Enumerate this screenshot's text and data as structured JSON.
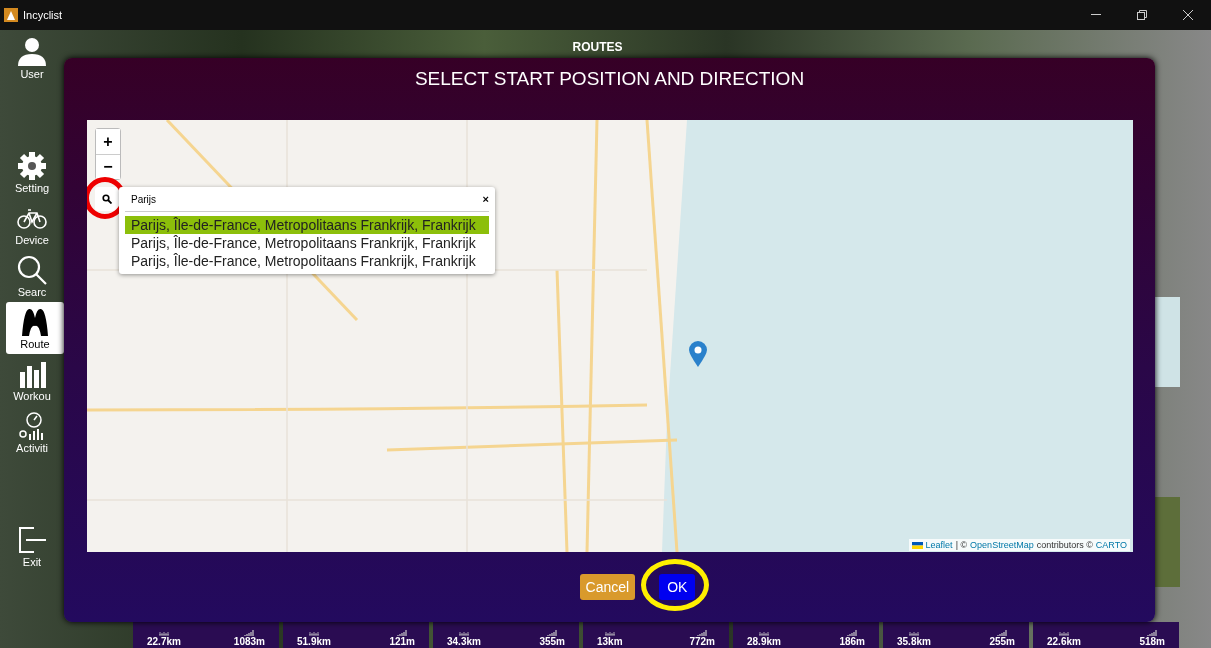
{
  "window": {
    "title": "Incyclist"
  },
  "sidebar": {
    "items": [
      {
        "label": "User",
        "kind": "user",
        "selected": false
      },
      {
        "label": "Setting",
        "kind": "gear",
        "selected": false
      },
      {
        "label": "Device",
        "kind": "bike",
        "selected": false
      },
      {
        "label": "Searc",
        "kind": "search",
        "selected": false
      },
      {
        "label": "Route",
        "kind": "route",
        "selected": true
      },
      {
        "label": "Workou",
        "kind": "bars",
        "selected": false
      },
      {
        "label": "Activiti",
        "kind": "gauge",
        "selected": false
      },
      {
        "label": "Exit",
        "kind": "exit",
        "selected": false
      }
    ]
  },
  "page": {
    "title": "ROUTES"
  },
  "route_cards": [
    {
      "distance": "22.7km",
      "elevation": "1083m"
    },
    {
      "distance": "51.9km",
      "elevation": "121m"
    },
    {
      "distance": "34.3km",
      "elevation": "355m"
    },
    {
      "distance": "13km",
      "elevation": "772m"
    },
    {
      "distance": "28.9km",
      "elevation": "186m"
    },
    {
      "distance": "35.8km",
      "elevation": "255m"
    },
    {
      "distance": "22.6km",
      "elevation": "518m"
    }
  ],
  "dialog": {
    "title": "SELECT START POSITION AND DIRECTION",
    "map": {
      "zoom_in": "+",
      "zoom_out": "−",
      "search": {
        "highlighted": true,
        "value": "Parijs",
        "clear": "×",
        "results": [
          {
            "label": "Parijs, Île-de-France, Metropolitaans Frankrijk, Frankrijk",
            "selected": true
          },
          {
            "label": "Parijs, Île-de-France, Metropolitaans Frankrijk, Frankrijk",
            "selected": false
          },
          {
            "label": "Parijs, Île-de-France, Metropolitaans Frankrijk, Frankrijk",
            "selected": false
          }
        ]
      },
      "attribution": {
        "leaflet": "Leaflet",
        "separator": "| ©",
        "osm": "OpenStreetMap",
        "contributors": "contributors ©",
        "carto": "CARTO"
      }
    },
    "buttons": [
      {
        "label": "Cancel",
        "kind": "cancel",
        "highlighted": false
      },
      {
        "label": "OK",
        "kind": "ok",
        "highlighted": true
      }
    ]
  }
}
